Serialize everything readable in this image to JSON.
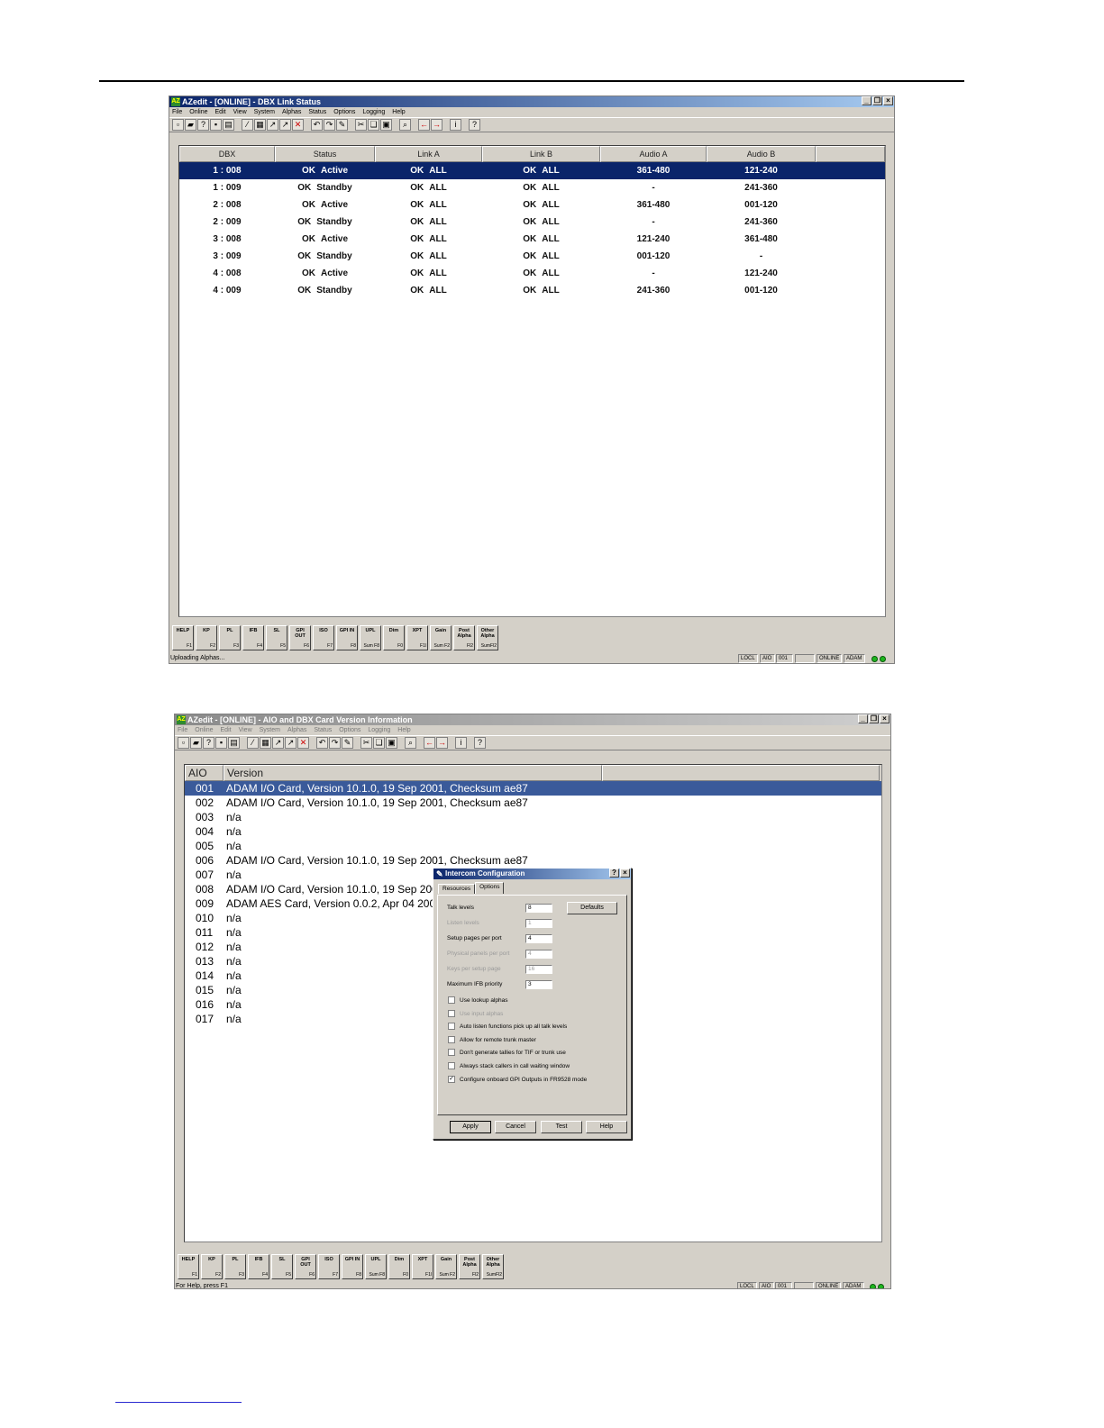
{
  "win1": {
    "title": "AZedit - [ONLINE] - DBX Link Status",
    "menu": [
      "File",
      "Online",
      "Edit",
      "View",
      "System",
      "Alphas",
      "Status",
      "Options",
      "Logging",
      "Help"
    ],
    "columns": [
      "DBX",
      "Status",
      "Link A",
      "Link B",
      "Audio A",
      "Audio B"
    ],
    "rows": [
      {
        "dbx": "1 : 008",
        "ok": "OK",
        "state": "Active",
        "la_ok": "OK",
        "la": "ALL",
        "lb_ok": "OK",
        "lb": "ALL",
        "aa": "361-480",
        "ab": "121-240"
      },
      {
        "dbx": "1 : 009",
        "ok": "OK",
        "state": "Standby",
        "la_ok": "OK",
        "la": "ALL",
        "lb_ok": "OK",
        "lb": "ALL",
        "aa": "-",
        "ab": "241-360"
      },
      {
        "dbx": "2 : 008",
        "ok": "OK",
        "state": "Active",
        "la_ok": "OK",
        "la": "ALL",
        "lb_ok": "OK",
        "lb": "ALL",
        "aa": "361-480",
        "ab": "001-120"
      },
      {
        "dbx": "2 : 009",
        "ok": "OK",
        "state": "Standby",
        "la_ok": "OK",
        "la": "ALL",
        "lb_ok": "OK",
        "lb": "ALL",
        "aa": "-",
        "ab": "241-360"
      },
      {
        "dbx": "3 : 008",
        "ok": "OK",
        "state": "Active",
        "la_ok": "OK",
        "la": "ALL",
        "lb_ok": "OK",
        "lb": "ALL",
        "aa": "121-240",
        "ab": "361-480"
      },
      {
        "dbx": "3 : 009",
        "ok": "OK",
        "state": "Standby",
        "la_ok": "OK",
        "la": "ALL",
        "lb_ok": "OK",
        "lb": "ALL",
        "aa": "001-120",
        "ab": "-"
      },
      {
        "dbx": "4 : 008",
        "ok": "OK",
        "state": "Active",
        "la_ok": "OK",
        "la": "ALL",
        "lb_ok": "OK",
        "lb": "ALL",
        "aa": "-",
        "ab": "121-240"
      },
      {
        "dbx": "4 : 009",
        "ok": "OK",
        "state": "Standby",
        "la_ok": "OK",
        "la": "ALL",
        "lb_ok": "OK",
        "lb": "ALL",
        "aa": "241-360",
        "ab": "001-120"
      }
    ],
    "status_text": "Uploading Alphas...",
    "status_boxes": [
      "LOCL",
      "AIO",
      "001",
      "",
      "ONLINE",
      "ADAM"
    ]
  },
  "fkeys": [
    {
      "k": "HELP",
      "f": "F1"
    },
    {
      "k": "KP",
      "f": "F2"
    },
    {
      "k": "PL",
      "f": "F3"
    },
    {
      "k": "IFB",
      "f": "F4"
    },
    {
      "k": "SL",
      "f": "F5"
    },
    {
      "k": "GPI OUT",
      "f": "F6"
    },
    {
      "k": "ISO",
      "f": "F7"
    },
    {
      "k": "GPI IN",
      "f": "F8"
    },
    {
      "k": "UPL",
      "f": "Sum F8"
    },
    {
      "k": "Dim",
      "f": "F0"
    },
    {
      "k": "XPT",
      "f": "F1l"
    },
    {
      "k": "Gain",
      "f": "Sum F2"
    },
    {
      "k": "Post Alpha",
      "f": "Fl2"
    },
    {
      "k": "Other Alpha",
      "f": "SumFl2"
    }
  ],
  "win2": {
    "title": "AZedit - [ONLINE] - AIO and DBX Card Version Information",
    "menu": [
      "File",
      "Online",
      "Edit",
      "View",
      "System",
      "Alphas",
      "Status",
      "Options",
      "Logging",
      "Help"
    ],
    "columns": [
      "AIO",
      "Version"
    ],
    "rows": [
      {
        "a": "001",
        "v": "ADAM I/O Card, Version 10.1.0, 19 Sep 2001, Checksum ae87"
      },
      {
        "a": "002",
        "v": "ADAM I/O Card, Version 10.1.0, 19 Sep 2001, Checksum ae87"
      },
      {
        "a": "003",
        "v": "n/a"
      },
      {
        "a": "004",
        "v": "n/a"
      },
      {
        "a": "005",
        "v": "n/a"
      },
      {
        "a": "006",
        "v": "ADAM I/O Card, Version 10.1.0, 19 Sep 2001, Checksum ae87"
      },
      {
        "a": "007",
        "v": "n/a"
      },
      {
        "a": "008",
        "v": "ADAM I/O Card, Version 10.1.0, 19 Sep 2001"
      },
      {
        "a": "009",
        "v": "ADAM AES Card, Version 0.0.2, Apr 04 2003"
      },
      {
        "a": "010",
        "v": "n/a"
      },
      {
        "a": "011",
        "v": "n/a"
      },
      {
        "a": "012",
        "v": "n/a"
      },
      {
        "a": "013",
        "v": "n/a"
      },
      {
        "a": "014",
        "v": "n/a"
      },
      {
        "a": "015",
        "v": "n/a"
      },
      {
        "a": "016",
        "v": "n/a"
      },
      {
        "a": "017",
        "v": "n/a"
      }
    ],
    "status_text": "For Help, press F1",
    "status_boxes": [
      "LOCL",
      "AIO",
      "001",
      "",
      "ONLINE",
      "ADAM"
    ]
  },
  "dialog": {
    "title": "Intercom Configuration",
    "tabs": [
      "Resources",
      "Options"
    ],
    "defaults_label": "Defaults",
    "fields": [
      {
        "label": "Talk levels",
        "value": "8"
      },
      {
        "label": "Listen levels",
        "value": "1"
      },
      {
        "label": "Setup pages per port",
        "value": "4"
      },
      {
        "label": "Physical panels per port",
        "value": "4"
      },
      {
        "label": "Keys per setup page",
        "value": "16"
      },
      {
        "label": "Maximum IFB priority",
        "value": "3"
      }
    ],
    "checks": [
      {
        "label": "Use lookup alphas",
        "mark": ""
      },
      {
        "label": "Use input alphas",
        "mark": ""
      },
      {
        "label": "Auto listen functions pick up all talk levels",
        "mark": ""
      },
      {
        "label": "Allow for remote trunk master",
        "mark": ""
      },
      {
        "label": "Don't generate tallies for TIF or trunk use",
        "mark": ""
      },
      {
        "label": "Always stack callers in call waiting window",
        "mark": ""
      },
      {
        "label": "Configure onboard GPI Outputs in FR9528 mode",
        "mark": "✓"
      }
    ],
    "buttons": {
      "apply": "Apply",
      "cancel": "Cancel",
      "test": "Test",
      "help": "Help"
    }
  }
}
